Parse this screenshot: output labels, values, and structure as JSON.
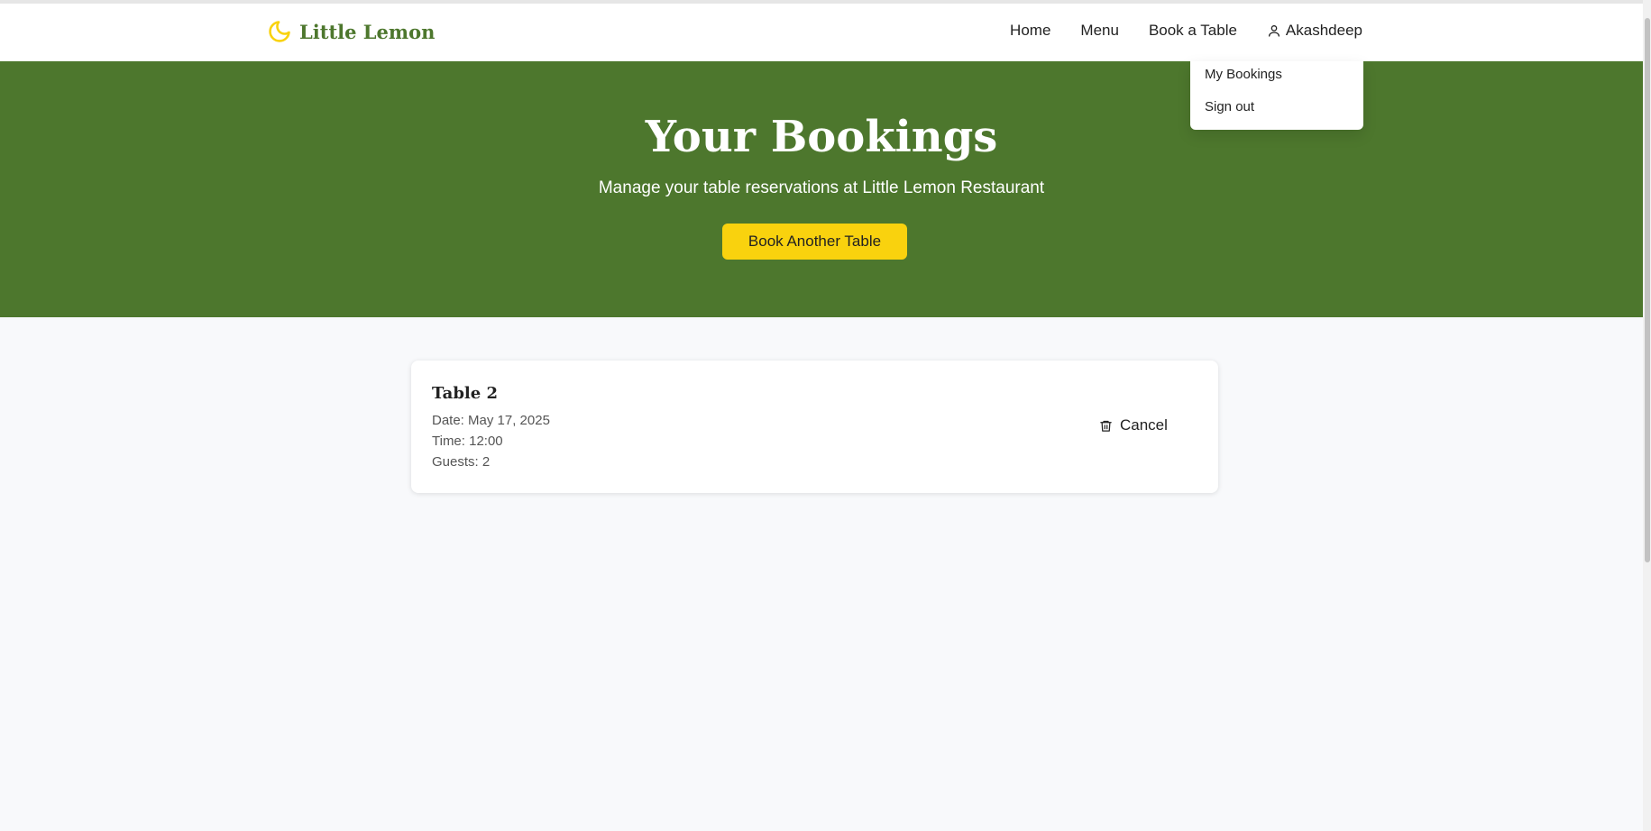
{
  "brand": {
    "name": "Little Lemon",
    "icon": "moon-icon",
    "color": "#4d772d",
    "icon_color": "#f9d20e"
  },
  "nav": {
    "links": [
      "Home",
      "Menu",
      "Book a Table"
    ],
    "user_name": "Akashdeep",
    "user_icon": "user-icon"
  },
  "dropdown": {
    "items": [
      "My Bookings",
      "Sign out"
    ]
  },
  "hero": {
    "title": "Your Bookings",
    "subtitle": "Manage your table reservations at Little Lemon Restaurant",
    "button_label": "Book Another Table",
    "background": "#4d772d",
    "button_color": "#f9d20e"
  },
  "bookings": [
    {
      "title": "Table 2",
      "date": "Date: May 17, 2025",
      "time": "Time: 12:00",
      "guests": "Guests: 2",
      "cancel_label": "Cancel",
      "cancel_icon": "trash-icon"
    }
  ]
}
